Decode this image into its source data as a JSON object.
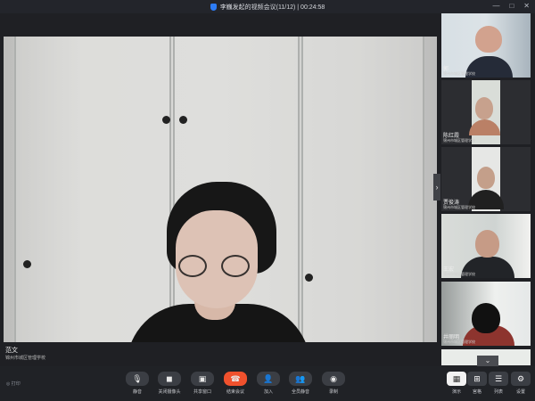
{
  "window": {
    "title": "李巍发起的视频会议(11/12) | 00:24:58",
    "controls": [
      "—",
      "□",
      "✕"
    ]
  },
  "main_video": {
    "participant_name": "范文",
    "organization": "锦州市城区管理学校"
  },
  "thumbnails": [
    {
      "name": "郭",
      "organization": "锦州市城区管理学校"
    },
    {
      "name": "陈红霞",
      "organization": "锦州市城区管理学校"
    },
    {
      "name": "贾俊涛",
      "organization": "锦州市城区管理学校"
    },
    {
      "name": "王宏",
      "organization": "锦州市城区管理学校"
    },
    {
      "name": "井丽明",
      "organization": "锦州市城区管理学校"
    }
  ],
  "toolbar": {
    "recording_label": "打印",
    "controls": [
      {
        "label": "静音",
        "icon": "🎙"
      },
      {
        "label": "关闭摄像头",
        "icon": "◼"
      },
      {
        "label": "共享窗口",
        "icon": "▣"
      },
      {
        "label": "结束会议",
        "icon": "☎"
      },
      {
        "label": "加入",
        "icon": "👤"
      },
      {
        "label": "全员静音",
        "icon": "👥"
      },
      {
        "label": "录制",
        "icon": "◉"
      }
    ],
    "right_controls": [
      {
        "label": "演示",
        "icon": "▦"
      },
      {
        "label": "宫格",
        "icon": "⊞"
      },
      {
        "label": "列表",
        "icon": "☰"
      },
      {
        "label": "设置",
        "icon": "⚙"
      }
    ]
  },
  "colors": {
    "accent": "#2d7cf6",
    "end_call": "#f0512d",
    "online": "#36c65d"
  }
}
